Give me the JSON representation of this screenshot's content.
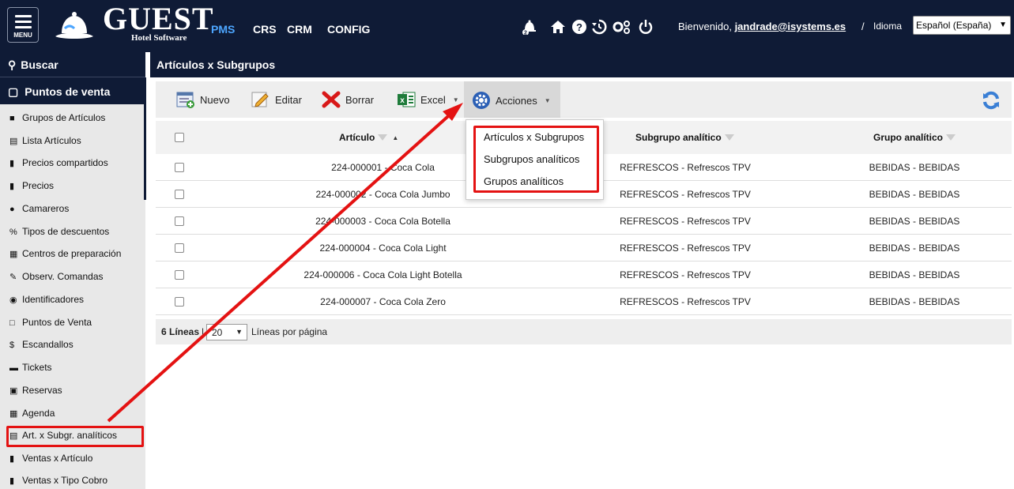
{
  "topbar": {
    "menu_label": "MENU",
    "logo_title": "GUEST",
    "logo_subtitle": "Hotel Software",
    "notification_count": "2",
    "nav": [
      "PMS",
      "CRS",
      "CRM",
      "CONFIG"
    ],
    "welcome_prefix": "Bienvenido, ",
    "user": "jandrade@isystems.es",
    "separator": "/",
    "language_label": "Idioma",
    "language_value": "Español (España)"
  },
  "sidebar": {
    "search": "Buscar",
    "section": "Puntos de venta",
    "items": [
      {
        "label": "Grupos de Artículos",
        "icon": "folder-icon"
      },
      {
        "label": "Lista Artículos",
        "icon": "list-icon"
      },
      {
        "label": "Precios compartidos",
        "icon": "file-icon"
      },
      {
        "label": "Precios",
        "icon": "file-dollar-icon"
      },
      {
        "label": "Camareros",
        "icon": "person-icon"
      },
      {
        "label": "Tipos de descuentos",
        "icon": "percent-icon"
      },
      {
        "label": "Centros de preparación",
        "icon": "building-icon"
      },
      {
        "label": "Observ. Comandas",
        "icon": "edit-icon"
      },
      {
        "label": "Identificadores",
        "icon": "user-circle-icon"
      },
      {
        "label": "Puntos de Venta",
        "icon": "monitor-icon"
      },
      {
        "label": "Escandallos",
        "icon": "dollar-icon"
      },
      {
        "label": "Tickets",
        "icon": "ticket-icon"
      },
      {
        "label": "Reservas",
        "icon": "calendar-icon"
      },
      {
        "label": "Agenda",
        "icon": "calendar-grid-icon"
      },
      {
        "label": "Art. x Subgr. analíticos",
        "icon": "table-icon"
      },
      {
        "label": "Ventas x Artículo",
        "icon": "file-icon"
      },
      {
        "label": "Ventas x Tipo Cobro",
        "icon": "file-icon"
      }
    ]
  },
  "page": {
    "title": "Artículos x Subgrupos"
  },
  "toolbar": {
    "new": "Nuevo",
    "edit": "Editar",
    "delete": "Borrar",
    "excel": "Excel",
    "actions": "Acciones"
  },
  "actions_menu": [
    "Artículos x Subgrupos",
    "Subgrupos analíticos",
    "Grupos analíticos"
  ],
  "table": {
    "columns": [
      "Artículo",
      "Subgrupo analítico",
      "Grupo analítico"
    ],
    "rows": [
      [
        "224-000001 - Coca Cola",
        "REFRESCOS - Refrescos TPV",
        "BEBIDAS - BEBIDAS"
      ],
      [
        "224-000002 - Coca Cola Jumbo",
        "REFRESCOS - Refrescos TPV",
        "BEBIDAS - BEBIDAS"
      ],
      [
        "224-000003 - Coca Cola Botella",
        "REFRESCOS - Refrescos TPV",
        "BEBIDAS - BEBIDAS"
      ],
      [
        "224-000004 - Coca Cola Light",
        "REFRESCOS - Refrescos TPV",
        "BEBIDAS - BEBIDAS"
      ],
      [
        "224-000006 - Coca Cola Light Botella",
        "REFRESCOS - Refrescos TPV",
        "BEBIDAS - BEBIDAS"
      ],
      [
        "224-000007 - Coca Cola Zero",
        "REFRESCOS - Refrescos TPV",
        "BEBIDAS - BEBIDAS"
      ]
    ]
  },
  "footer": {
    "count": "6 Líneas",
    "separator": "|",
    "page_size": "20",
    "per_page_label": "Líneas por página"
  },
  "colors": {
    "header_bg": "#0f1b36",
    "active_nav": "#4da6ff",
    "annotation_red": "#e41212"
  }
}
